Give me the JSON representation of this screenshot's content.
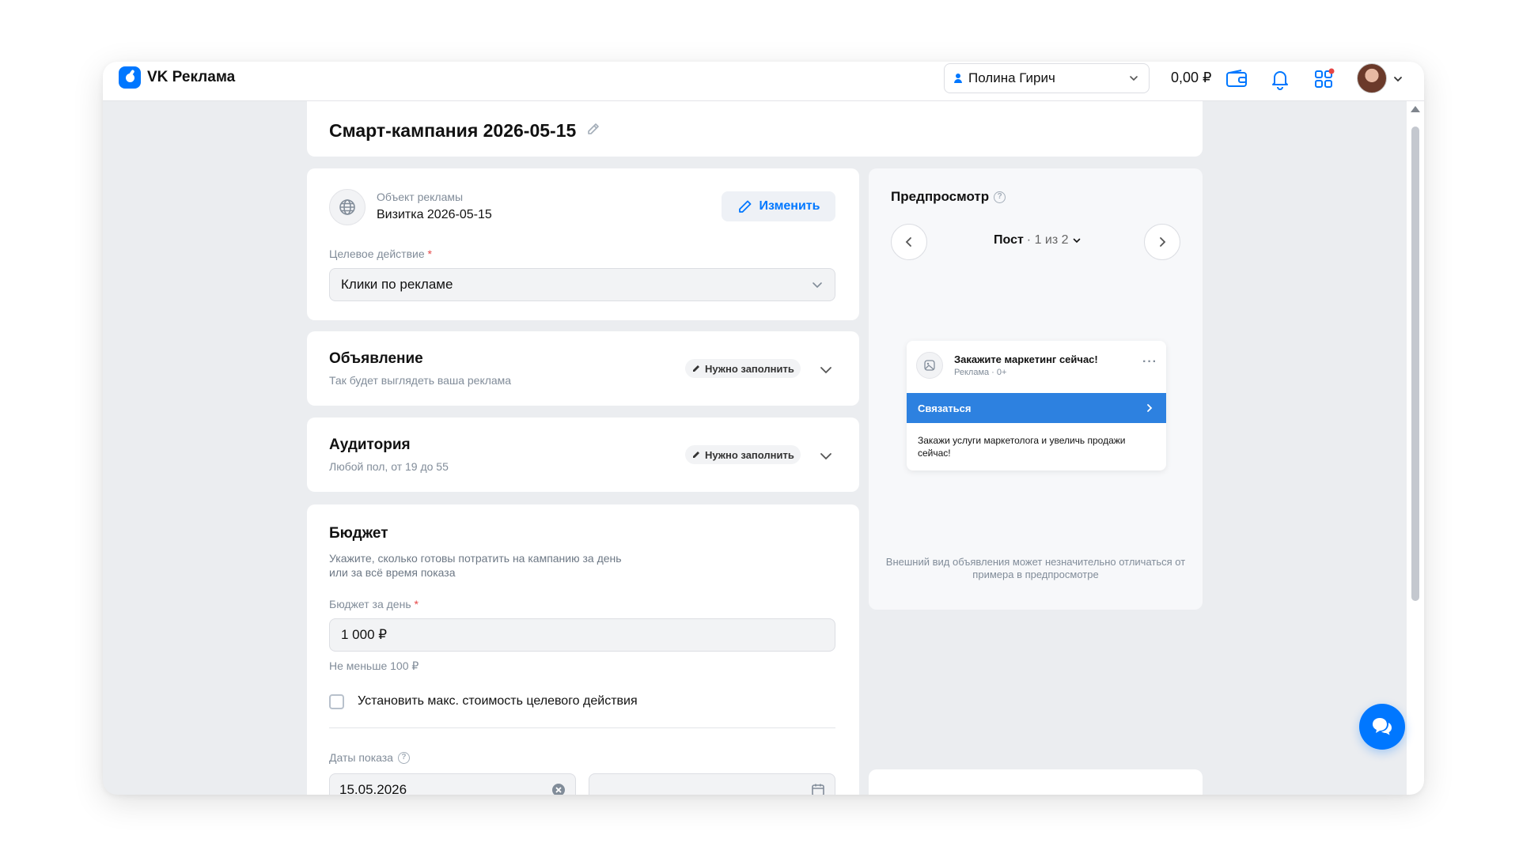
{
  "header": {
    "logo_text": "VK Реклама",
    "account_name": "Полина Гирич",
    "balance": "0,00 ₽"
  },
  "campaign": {
    "title": "Смарт-кампания 2026-05-15"
  },
  "ad_object": {
    "label": "Объект рекламы",
    "value": "Визитка 2026-05-15",
    "change_button": "Изменить",
    "target_action_label": "Целевое действие",
    "target_action_value": "Клики по рекламе"
  },
  "sections": {
    "ad": {
      "title": "Объявление",
      "subtitle": "Так будет выглядеть ваша реклама",
      "status": "Нужно заполнить"
    },
    "audience": {
      "title": "Аудитория",
      "subtitle": "Любой пол, от 19 до 55",
      "status": "Нужно заполнить"
    }
  },
  "budget": {
    "title": "Бюджет",
    "description_line1": "Укажите, сколько готовы потратить на кампанию за день",
    "description_line2": "или за всё время показа",
    "daily_label": "Бюджет за день",
    "daily_value": "1 000 ₽",
    "daily_hint": "Не меньше 100 ₽",
    "max_cost_checkbox": "Установить макс. стоимость целевого действия",
    "max_cost_checked": false,
    "dates_label": "Даты показа",
    "start_date": "15.05.2026",
    "end_date": ""
  },
  "preview": {
    "title": "Предпросмотр",
    "format": "Пост",
    "position": "· 1 из 2",
    "ad_title": "Закажите маркетинг сейчас!",
    "ad_meta": "Реклама · 0+",
    "cta_label": "Связаться",
    "ad_text": "Закажи услуги маркетолога и увеличь продажи сейчас!",
    "note": "Внешний вид объявления может незначительно отличаться от примера в предпросмотре"
  },
  "colors": {
    "accent": "#0077ff",
    "cta": "#2d81e0",
    "required": "#e64646"
  },
  "icons": {
    "logo": "vk-ads-logo-icon",
    "wallet": "wallet-icon",
    "bell": "bell-icon",
    "apps": "apps-grid-icon",
    "chat": "chat-bubbles-icon",
    "globe": "globe-icon",
    "pencil": "pencil-icon",
    "calendar": "calendar-icon",
    "clear": "clear-circle-icon"
  }
}
